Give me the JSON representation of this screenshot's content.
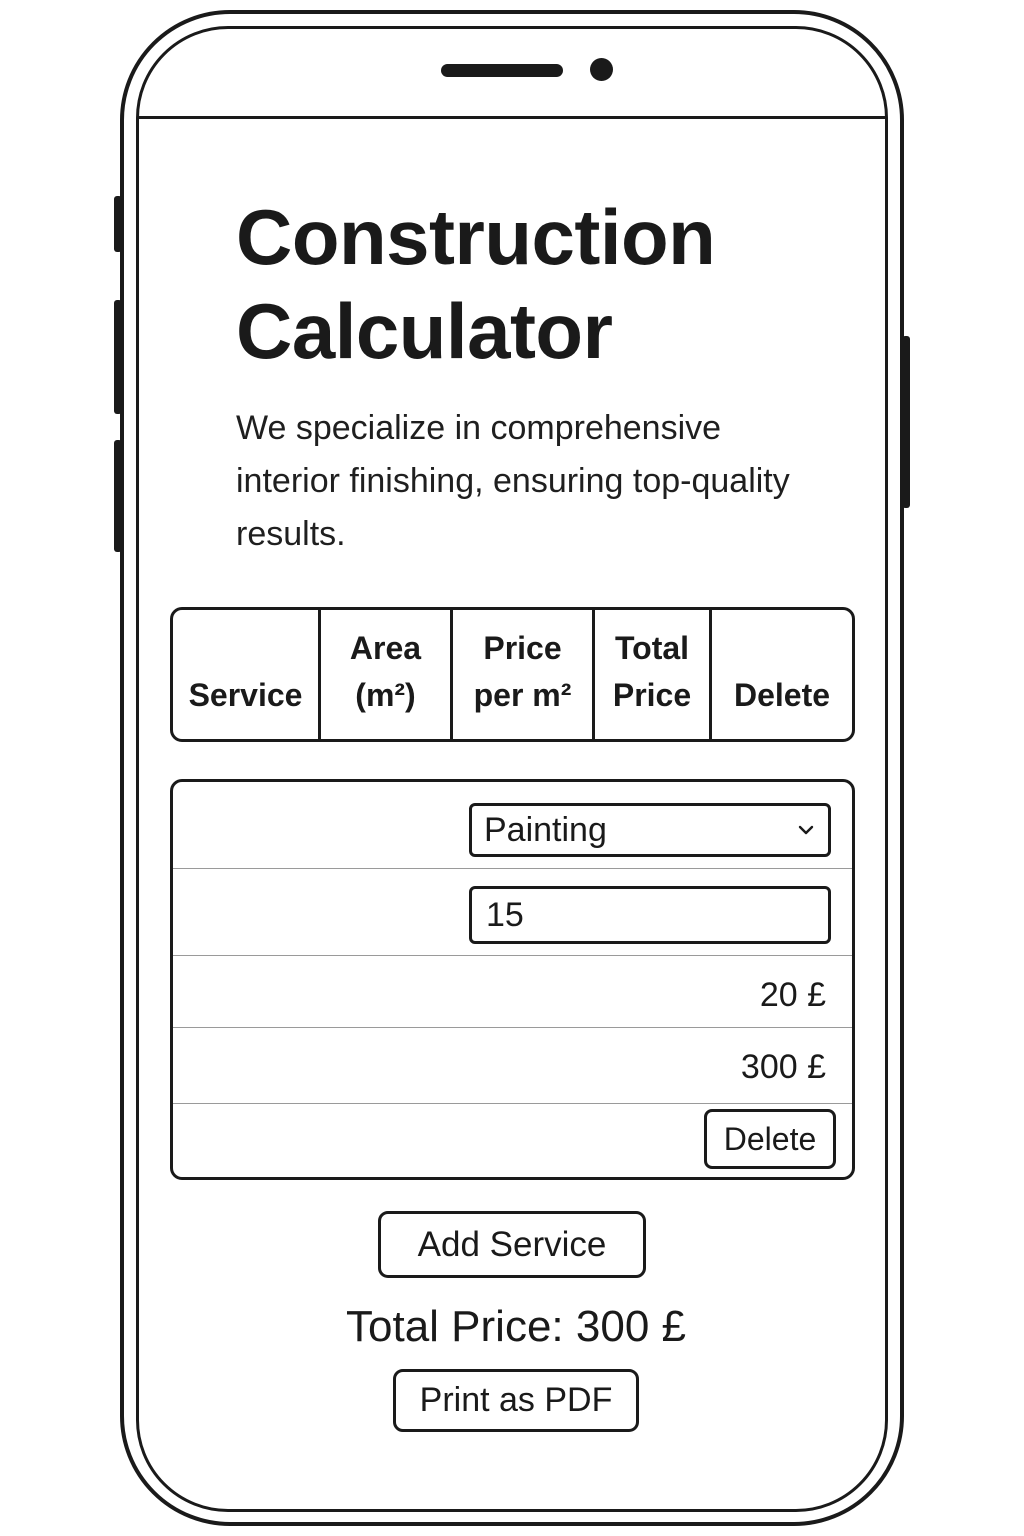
{
  "page": {
    "title": "Construction Calculator",
    "description": "We specialize in comprehensive interior finishing, ensuring top-quality results."
  },
  "table": {
    "headers": [
      {
        "label": "Service"
      },
      {
        "label": "Area\n(m²)"
      },
      {
        "label": "Price\nper m²"
      },
      {
        "label": "Total\nPrice"
      },
      {
        "label": "Delete"
      }
    ]
  },
  "row": {
    "service": "Painting",
    "area": "15",
    "price_per_m2": "20 £",
    "total_price": "300 £",
    "delete_label": "Delete"
  },
  "actions": {
    "add_service_label": "Add Service",
    "total_label": "Total Price: 300 £",
    "print_label": "Print as PDF"
  },
  "icons": {
    "select_arrow": "chevron-down-icon"
  }
}
